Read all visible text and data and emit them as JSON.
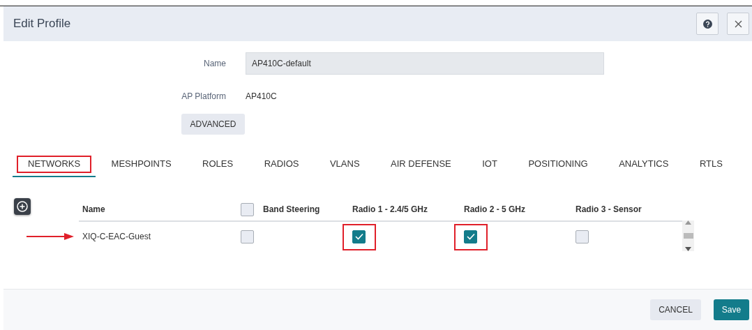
{
  "header": {
    "title": "Edit Profile"
  },
  "form": {
    "name_label": "Name",
    "name_value": "AP410C-default",
    "platform_label": "AP Platform",
    "platform_value": "AP410C",
    "advanced_button": "ADVANCED"
  },
  "tabs": [
    {
      "label": "NETWORKS",
      "selected": true,
      "highlighted": true
    },
    {
      "label": "MESHPOINTS",
      "selected": false,
      "highlighted": false
    },
    {
      "label": "ROLES",
      "selected": false,
      "highlighted": false
    },
    {
      "label": "RADIOS",
      "selected": false,
      "highlighted": false
    },
    {
      "label": "VLANS",
      "selected": false,
      "highlighted": false
    },
    {
      "label": "AIR DEFENSE",
      "selected": false,
      "highlighted": false
    },
    {
      "label": "IOT",
      "selected": false,
      "highlighted": false
    },
    {
      "label": "POSITIONING",
      "selected": false,
      "highlighted": false
    },
    {
      "label": "ANALYTICS",
      "selected": false,
      "highlighted": false
    },
    {
      "label": "RTLS",
      "selected": false,
      "highlighted": false
    }
  ],
  "table": {
    "columns": [
      {
        "label": "Name"
      },
      {
        "label": "Band Steering",
        "checked": false
      },
      {
        "label": "Radio 1 - 2.4/5 GHz"
      },
      {
        "label": "Radio 2 - 5 GHz"
      },
      {
        "label": "Radio 3 - Sensor"
      }
    ],
    "rows": [
      {
        "name": "XIQ-C-EAC-Guest",
        "pointed": true,
        "checks": [
          {
            "checked": false,
            "highlighted": false
          },
          {
            "checked": true,
            "highlighted": true
          },
          {
            "checked": true,
            "highlighted": true
          },
          {
            "checked": false,
            "highlighted": false
          }
        ]
      }
    ]
  },
  "footer": {
    "cancel": "CANCEL",
    "save": "Save"
  }
}
